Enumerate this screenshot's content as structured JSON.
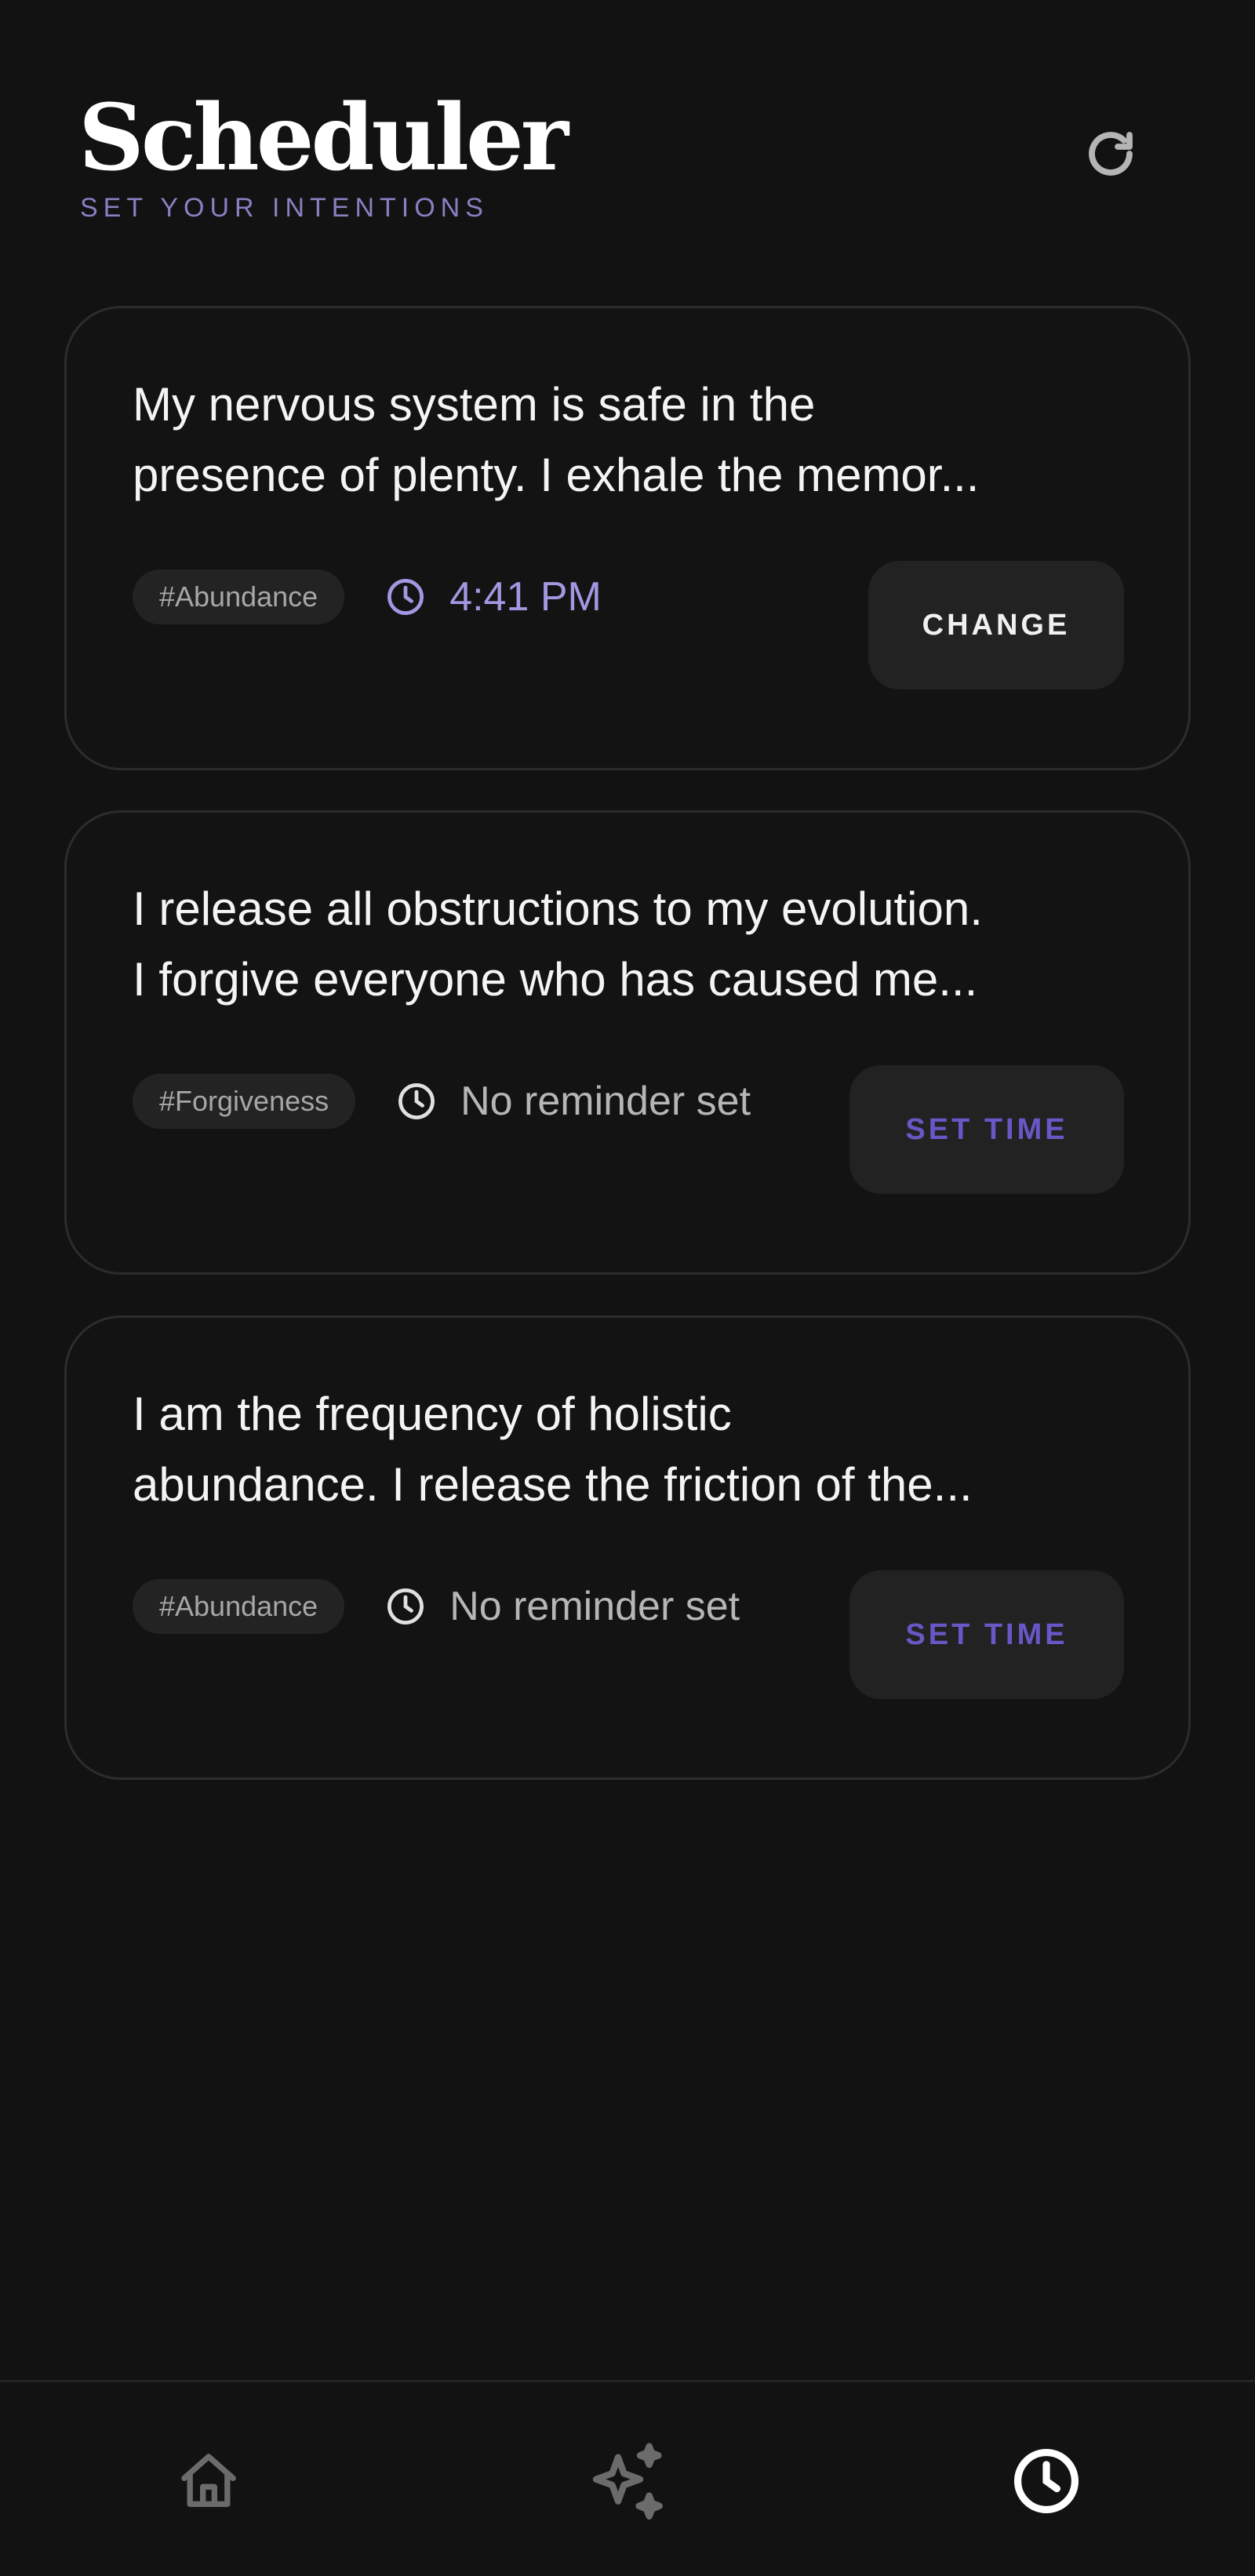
{
  "header": {
    "title": "Scheduler",
    "subtitle": "SET YOUR INTENTIONS",
    "refresh_icon": "refresh-icon"
  },
  "cards": [
    {
      "text_line1": "My nervous system is safe in the",
      "text_line2": "presence of plenty. I exhale the memor...",
      "tag": "#Abundance",
      "time": "4:41 PM",
      "reminder_set": true,
      "action": "CHANGE"
    },
    {
      "text_line1": "I release all obstructions to my evolution.",
      "text_line2": "I forgive everyone who has caused me...",
      "tag": "#Forgiveness",
      "time": "No reminder set",
      "reminder_set": false,
      "action": "SET TIME"
    },
    {
      "text_line1": "I am the frequency of holistic",
      "text_line2": "abundance. I release the friction of the...",
      "tag": "#Abundance",
      "time": "No reminder set",
      "reminder_set": false,
      "action": "SET TIME"
    }
  ],
  "nav": {
    "items": [
      "home-icon",
      "sparkles-icon",
      "clock-icon"
    ],
    "active": "clock-icon"
  },
  "colors": {
    "background": "#121212",
    "accent": "#a596e2",
    "accent_dark": "#6a56c6",
    "subtitle": "#8a7fc2"
  }
}
